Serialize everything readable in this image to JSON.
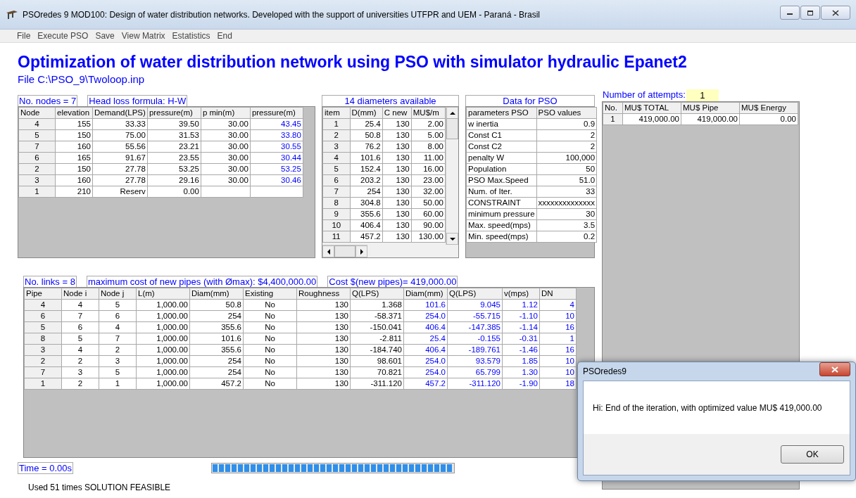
{
  "window": {
    "title": "PSOredes 9 MOD100: Design of water distribution networks. Developed with the support of universities UTFPR and UEM - Paraná - Brasil"
  },
  "menu": [
    "File",
    "Execute PSO",
    "Save",
    "View Matrix",
    "Estatistics",
    "End"
  ],
  "heading": "Optimization of water distribution network using PSO with simulator hydraulic Epanet2",
  "file_path": "File C:\\PSO_9\\Twoloop.inp",
  "nodes": {
    "count_label": "No. nodes = 7",
    "formula_label": "Head loss formula: H-W",
    "columns": [
      {
        "label": "Node",
        "kind": "input"
      },
      {
        "label": "elevation",
        "kind": "input"
      },
      {
        "label": "Demand(LPS)",
        "kind": "input"
      },
      {
        "label": "pressure(m)",
        "kind": "input"
      },
      {
        "label": "p min(m)",
        "kind": "input"
      },
      {
        "label": "pressure(m)",
        "kind": "result"
      }
    ],
    "rows": [
      [
        "4",
        "155",
        "33.33",
        "39.50",
        "30.00",
        "43.45"
      ],
      [
        "5",
        "150",
        "75.00",
        "31.53",
        "30.00",
        "33.80"
      ],
      [
        "7",
        "160",
        "55.56",
        "23.21",
        "30.00",
        "30.55"
      ],
      [
        "6",
        "165",
        "91.67",
        "23.55",
        "30.00",
        "30.44"
      ],
      [
        "2",
        "150",
        "27.78",
        "53.25",
        "30.00",
        "53.25"
      ],
      [
        "3",
        "160",
        "27.78",
        "29.16",
        "30.00",
        "30.46"
      ],
      [
        "1",
        "210",
        "Reserv",
        "0.00",
        "",
        ""
      ]
    ]
  },
  "diameters": {
    "title": "14 diameters available",
    "columns": [
      {
        "label": "item",
        "kind": "input"
      },
      {
        "label": "D(mm)",
        "kind": "input"
      },
      {
        "label": "C new",
        "kind": "input"
      },
      {
        "label": "MU$/m",
        "kind": "input"
      }
    ],
    "rows": [
      [
        "1",
        "25.4",
        "130",
        "2.00"
      ],
      [
        "2",
        "50.8",
        "130",
        "5.00"
      ],
      [
        "3",
        "76.2",
        "130",
        "8.00"
      ],
      [
        "4",
        "101.6",
        "130",
        "11.00"
      ],
      [
        "5",
        "152.4",
        "130",
        "16.00"
      ],
      [
        "6",
        "203.2",
        "130",
        "23.00"
      ],
      [
        "7",
        "254",
        "130",
        "32.00"
      ],
      [
        "8",
        "304.8",
        "130",
        "50.00"
      ],
      [
        "9",
        "355.6",
        "130",
        "60.00"
      ],
      [
        "10",
        "406.4",
        "130",
        "90.00"
      ],
      [
        "11",
        "457.2",
        "130",
        "130.00"
      ]
    ]
  },
  "pso": {
    "title": "Data for PSO",
    "columns": [
      {
        "label": "parameters PSO",
        "kind": "input"
      },
      {
        "label": "PSO values",
        "kind": "input"
      }
    ],
    "rows": [
      [
        "w inertia",
        "0.9"
      ],
      [
        "Const C1",
        "2"
      ],
      [
        "Const C2",
        "2"
      ],
      [
        "penalty W",
        "100,000"
      ],
      [
        "Population",
        "50"
      ],
      [
        "PSO Max.Speed",
        "51.0"
      ],
      [
        "Num. of Iter.",
        "33"
      ],
      [
        "CONSTRAINT",
        "xxxxxxxxxxxxxx"
      ],
      [
        "minimum pressure",
        "30"
      ],
      [
        "Max. speed(mps)",
        "3.5"
      ],
      [
        "Min. speed(mps)",
        "0.2"
      ]
    ]
  },
  "attempts": {
    "label": "Number of attempts:",
    "value": "1",
    "columns": [
      {
        "label": "No.",
        "kind": "input"
      },
      {
        "label": "MU$ TOTAL",
        "kind": "input"
      },
      {
        "label": "MU$ Pipe",
        "kind": "input"
      },
      {
        "label": "MU$ Energy",
        "kind": "input"
      }
    ],
    "rows": [
      [
        "1",
        "419,000.00",
        "419,000.00",
        "0.00"
      ]
    ]
  },
  "links": {
    "count_label": "No. links = 8",
    "max_cost_label": "maximum cost of new pipes (with Ømax): $4,400,000.00",
    "cost_label": "Cost $(new pipes)= 419,000.00",
    "columns": [
      {
        "label": "Pipe",
        "kind": "input"
      },
      {
        "label": "Node i",
        "kind": "input"
      },
      {
        "label": "Node j",
        "kind": "input"
      },
      {
        "label": "L(m)",
        "kind": "input"
      },
      {
        "label": "Diam(mm)",
        "kind": "input"
      },
      {
        "label": "Existing",
        "kind": "input"
      },
      {
        "label": "Roughness",
        "kind": "input"
      },
      {
        "label": "Q(LPS)",
        "kind": "input"
      },
      {
        "label": "Diam(mm)",
        "kind": "result"
      },
      {
        "label": "Q(LPS)",
        "kind": "result"
      },
      {
        "label": "v(mps)",
        "kind": "result"
      },
      {
        "label": "DN",
        "kind": "result"
      }
    ],
    "rows": [
      [
        "4",
        "4",
        "5",
        "1,000.00",
        "50.8",
        "No",
        "130",
        "1.368",
        "101.6",
        "9.045",
        "1.12",
        "4"
      ],
      [
        "6",
        "7",
        "6",
        "1,000.00",
        "254",
        "No",
        "130",
        "-58.371",
        "254.0",
        "-55.715",
        "-1.10",
        "10"
      ],
      [
        "5",
        "6",
        "4",
        "1,000.00",
        "355.6",
        "No",
        "130",
        "-150.041",
        "406.4",
        "-147.385",
        "-1.14",
        "16"
      ],
      [
        "8",
        "5",
        "7",
        "1,000.00",
        "101.6",
        "No",
        "130",
        "-2.811",
        "25.4",
        "-0.155",
        "-0.31",
        "1"
      ],
      [
        "3",
        "4",
        "2",
        "1,000.00",
        "355.6",
        "No",
        "130",
        "-184.740",
        "406.4",
        "-189.761",
        "-1.46",
        "16"
      ],
      [
        "2",
        "2",
        "3",
        "1,000.00",
        "254",
        "No",
        "130",
        "98.601",
        "254.0",
        "93.579",
        "1.85",
        "10"
      ],
      [
        "7",
        "3",
        "5",
        "1,000.00",
        "254",
        "No",
        "130",
        "70.821",
        "254.0",
        "65.799",
        "1.30",
        "10"
      ],
      [
        "1",
        "2",
        "1",
        "1,000.00",
        "457.2",
        "No",
        "130",
        "-311.120",
        "457.2",
        "-311.120",
        "-1.90",
        "18"
      ]
    ]
  },
  "time_label": "Time = 0.00s",
  "progress": {
    "level": 1
  },
  "status": "Used 51 times SOLUTION FEASIBLE",
  "dialog": {
    "title": "PSOredes9",
    "message": "Hi: End of the iteration, with optimized value MU$ 419,000.00",
    "button": "OK"
  }
}
